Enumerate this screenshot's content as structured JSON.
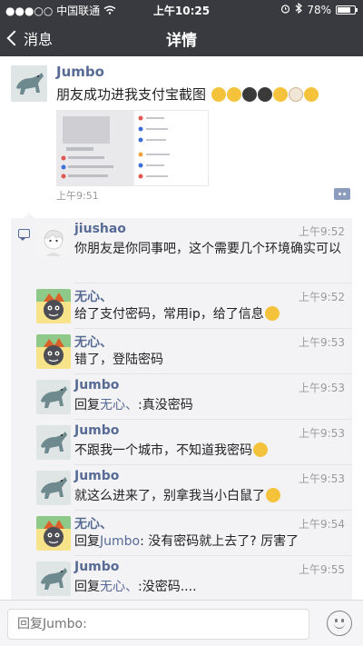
{
  "status": {
    "carrier": "●●●○○ 中国联通",
    "time": "上午10:25",
    "battery": "78%",
    "battery_level": 0.78
  },
  "nav": {
    "back_label": "消息",
    "title": "详情"
  },
  "post": {
    "author": "Jumbo",
    "text": "朋友成功进我支付宝截图",
    "time": "上午9:51"
  },
  "comments": [
    {
      "name": "jiushao",
      "time": "上午9:52",
      "text": "你朋友是你同事吧，这个需要几个环境确实可以"
    },
    {
      "name": "无心、",
      "time": "上午9:52",
      "text": "给了支付密码，常用ip，给了信息"
    },
    {
      "name": "无心、",
      "time": "上午9:53",
      "text": "错了，登陆密码"
    },
    {
      "name": "Jumbo",
      "time": "上午9:53",
      "reply_prefix": "回复",
      "reply_to": "无心、",
      "text": ":真没密码"
    },
    {
      "name": "Jumbo",
      "time": "上午9:53",
      "text": "不跟我一个城市，不知道我密码"
    },
    {
      "name": "Jumbo",
      "time": "上午9:53",
      "text": "就这么进来了，别拿我当小白鼠了"
    },
    {
      "name": "无心、",
      "time": "上午9:54",
      "reply_prefix": "回复",
      "reply_to": "Jumbo",
      "text": ": 没有密码就上去了? 厉害了"
    },
    {
      "name": "Jumbo",
      "time": "上午9:55",
      "reply_prefix": "回复",
      "reply_to": "无心、",
      "text": ":没密码...."
    }
  ],
  "input": {
    "placeholder": "回复Jumbo:"
  },
  "colors": {
    "nav_bg": "#393a3f",
    "link": "#576b95",
    "comment_bg": "#f3f3f5"
  }
}
